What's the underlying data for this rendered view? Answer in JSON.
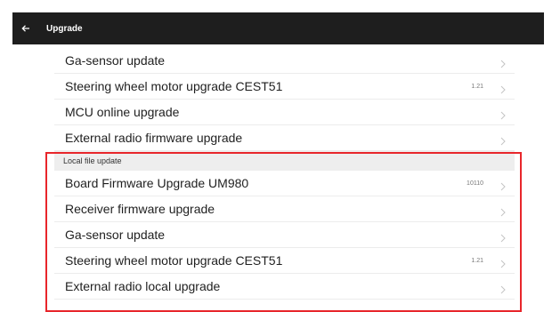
{
  "header": {
    "title": "Upgrade",
    "back_icon": "arrow-left-icon"
  },
  "colors": {
    "header_bg": "#1e1e1e",
    "highlight": "#e8262b"
  },
  "online_items": [
    {
      "label": "Ga-sensor update",
      "value": ""
    },
    {
      "label": "Steering wheel motor upgrade CEST51",
      "value": "1.21"
    },
    {
      "label": "MCU online upgrade",
      "value": ""
    },
    {
      "label": "External radio firmware upgrade",
      "value": ""
    }
  ],
  "local_section": {
    "title": "Local file update",
    "items": [
      {
        "label": "Board Firmware Upgrade  UM980",
        "value": "10110"
      },
      {
        "label": "Receiver firmware upgrade",
        "value": ""
      },
      {
        "label": "Ga-sensor update",
        "value": ""
      },
      {
        "label": "Steering wheel motor upgrade CEST51",
        "value": "1.21"
      },
      {
        "label": "External radio local upgrade",
        "value": ""
      }
    ]
  }
}
